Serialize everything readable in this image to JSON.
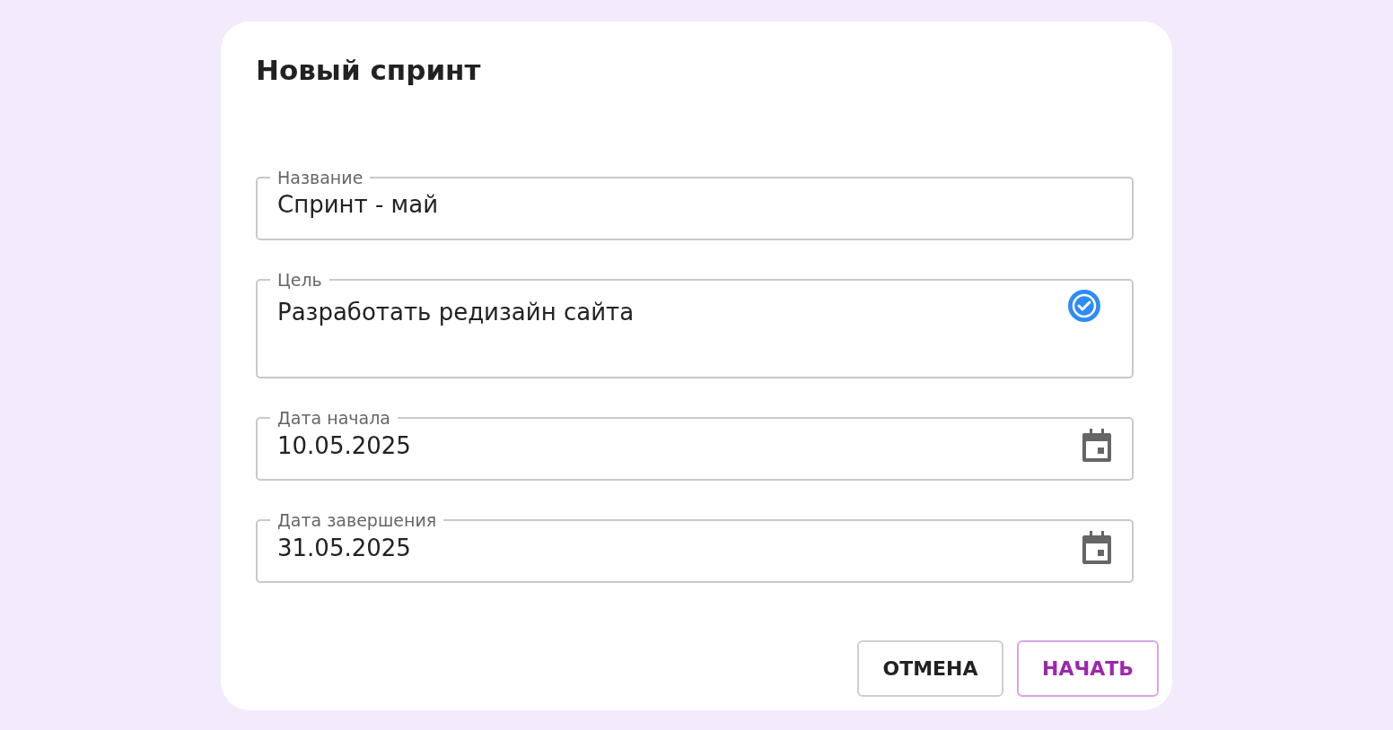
{
  "dialog": {
    "title": "Новый спринт"
  },
  "fields": [
    {
      "kind": "text",
      "label": "Название",
      "value": "Спринт - май"
    },
    {
      "kind": "multiline",
      "label": "Цель",
      "value": "Разработать редизайн сайта"
    },
    {
      "kind": "date",
      "label": "Дата начала",
      "value": "10.05.2025"
    },
    {
      "kind": "date",
      "label": "Дата завершения",
      "value": "31.05.2025"
    }
  ],
  "buttons": [
    {
      "kind": "secondary",
      "label": "ОТМЕНА"
    },
    {
      "kind": "primary",
      "label": "НАЧАТЬ"
    }
  ]
}
